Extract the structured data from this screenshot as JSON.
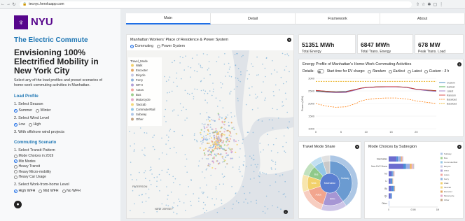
{
  "browser": {
    "url": "tecnyc.herokuapp.com"
  },
  "sidebar": {
    "logo_text": "NYU",
    "app_title": "The Electric Commute",
    "heading": "Envisioning 100% Electrified Mobility in New York City",
    "intro": "Select any of the load profiles and preset scenarios of home-work commuting activities in Manhattan.",
    "load_profile_title": "Load Profile",
    "season_label": "1. Select Season",
    "season_options": [
      "Summer",
      "Winter"
    ],
    "wind_label": "2. Select Wind Level",
    "wind_options": [
      "Low",
      "High"
    ],
    "offshore_label": "3. With offshore wind projects",
    "commuting_title": "Commuting Scenario",
    "transit_label": "1. Select Transit Pattern",
    "transit_options": [
      "Mode Choices in 2019",
      "Mix Modes",
      "Heavy Transit",
      "Heavy Micro-mobility",
      "Heavy Car Usage"
    ],
    "wfh_label": "2. Select Work-from-home Level",
    "wfh_options": [
      "High WFH",
      "Mid WFH",
      "No WFH"
    ]
  },
  "tabs": [
    "Main",
    "Detail",
    "Framework",
    "About"
  ],
  "map_card": {
    "title": "Manhattan Workers' Place of Residence & Power System",
    "toggle_options": [
      "Commuting",
      "Power System"
    ],
    "legend_title": "Travel_Mode",
    "legend_items": [
      {
        "label": "Walk",
        "color": "#f2d16b"
      },
      {
        "label": "Escooter",
        "color": "#e3a765"
      },
      {
        "label": "Bicycle",
        "color": "#c7c9e6"
      },
      {
        "label": "Ferry",
        "color": "#8fb3de"
      },
      {
        "label": "WFH",
        "color": "#b2a0d8"
      },
      {
        "label": "Autos",
        "color": "#f4a6a0"
      },
      {
        "label": "Bus",
        "color": "#9ed08f"
      },
      {
        "label": "Motorcycle",
        "color": "#e6a8c8"
      },
      {
        "label": "Taxicab",
        "color": "#f5d97c"
      },
      {
        "label": "CommuterRail",
        "color": "#93c7e6"
      },
      {
        "label": "Subway",
        "color": "#aec7e8"
      },
      {
        "label": "Other",
        "color": "#c4a484"
      }
    ],
    "place_labels": [
      "PATERSON",
      "NEW JERSEY"
    ]
  },
  "stats": [
    {
      "value": "51351 MWh",
      "label": "Total Energy"
    },
    {
      "value": "6847 MWh",
      "label": "Total Trans. Energy"
    },
    {
      "value": "678 MW",
      "label": "Peak Trans. Load"
    }
  ],
  "energy_card": {
    "title": "Energy Profile of Manhattan's Home-Work Commuting Activities",
    "details_label": "Details:",
    "ev_label": "Start time for EV charge:",
    "ev_options": [
      "Random",
      "Earliest",
      "Latest",
      "Custom - 3 h"
    ]
  },
  "chart_data": [
    {
      "type": "line",
      "title": "",
      "xlabel": "",
      "ylabel": "Power (MW)",
      "xlim": [
        0,
        24
      ],
      "ylim": [
        1000,
        3000
      ],
      "xticks": [
        0,
        5,
        10,
        15,
        20
      ],
      "yticks": [
        1000,
        1500,
        2000,
        2500,
        3000
      ],
      "legend_position": "right",
      "series": [
        {
          "name": "Custom",
          "color": "#1f77b4",
          "dash": false,
          "x": [
            0,
            2,
            4,
            6,
            8,
            9,
            10,
            12,
            14,
            16,
            18,
            19,
            20,
            22,
            24
          ],
          "y": [
            2520,
            2490,
            2470,
            2480,
            2560,
            2600,
            2630,
            2650,
            2660,
            2660,
            2640,
            2600,
            2560,
            2530,
            2510
          ]
        },
        {
          "name": "Earliest",
          "color": "#2ca02c",
          "dash": false,
          "x": [
            0,
            2,
            4,
            6,
            8,
            9,
            10,
            12,
            14,
            16,
            18,
            19,
            20,
            22,
            24
          ],
          "y": [
            2500,
            2470,
            2450,
            2460,
            2560,
            2610,
            2640,
            2660,
            2670,
            2670,
            2650,
            2610,
            2570,
            2530,
            2500
          ]
        },
        {
          "name": "Latest",
          "color": "#9467bd",
          "dash": false,
          "x": [
            0,
            2,
            4,
            6,
            8,
            9,
            10,
            12,
            14,
            16,
            18,
            19,
            20,
            22,
            24
          ],
          "y": [
            2480,
            2450,
            2430,
            2440,
            2540,
            2600,
            2630,
            2650,
            2660,
            2660,
            2640,
            2600,
            2560,
            2510,
            2480
          ]
        },
        {
          "name": "Random",
          "color": "#d62728",
          "dash": false,
          "x": [
            0,
            2,
            4,
            6,
            8,
            9,
            10,
            12,
            14,
            16,
            18,
            19,
            20,
            22,
            24
          ],
          "y": [
            2520,
            2490,
            2460,
            2470,
            2560,
            2610,
            2640,
            2660,
            2670,
            2670,
            2650,
            2610,
            2570,
            2540,
            2510
          ]
        },
        {
          "name": "Baseload",
          "color": "#ff7f0e",
          "dash": true,
          "x": [
            0,
            2,
            4,
            6,
            8,
            9,
            10,
            12,
            14,
            16,
            18,
            19,
            20,
            22,
            24
          ],
          "y": [
            2000,
            1900,
            1850,
            1870,
            2000,
            2100,
            2150,
            2200,
            2220,
            2220,
            2180,
            2150,
            2100,
            2050,
            2000
          ]
        },
        {
          "name": "Baseload",
          "color": "#e6a500",
          "dash": true,
          "x": [
            0,
            2,
            4,
            6,
            8,
            9,
            10,
            12,
            14,
            16,
            18,
            19,
            20,
            22,
            24
          ],
          "y": [
            2880,
            2880,
            2880,
            2880,
            2880,
            2880,
            2880,
            2880,
            2880,
            2880,
            2880,
            2880,
            2880,
            2880,
            2880
          ]
        }
      ]
    },
    {
      "type": "pie",
      "title": "Travel Mode Share",
      "labels": [
        "Subway",
        "WFH",
        "Autos",
        "Walk",
        "Bus",
        "CommuterRail",
        "Other"
      ],
      "values": [
        40,
        15,
        15,
        10,
        8,
        7,
        5
      ],
      "colors": [
        "#6b9bd1",
        "#a696d4",
        "#f2a58e",
        "#f2d16b",
        "#8fc98a",
        "#93c7e6",
        "#c9c9c9"
      ],
      "center_label": "Manhattan"
    },
    {
      "type": "bar",
      "title": "Mode Choices by Subregion",
      "orientation": "horizontal",
      "stacked": true,
      "categories": [
        "Manhattan",
        "Non-NYC Bronx",
        "NJ",
        "LI",
        "Bk",
        "Qn",
        "Other"
      ],
      "xlim": [
        0,
        1
      ],
      "xticks": [
        "0",
        "0.5M",
        "1M"
      ],
      "legend_position": "right",
      "legend": [
        "Subway",
        "Bus",
        "CommuterRail",
        "Bicycle",
        "WFH",
        "Autos",
        "Ferry",
        "Walk",
        "Taxicab",
        "Escooter",
        "Motorcycle",
        "Other"
      ],
      "legend_colors": [
        "#aec7e8",
        "#9ed08f",
        "#93c7e6",
        "#c7c9e6",
        "#b2a0d8",
        "#f4a6a0",
        "#8fb3de",
        "#f2d16b",
        "#f5d97c",
        "#e3a765",
        "#e6a8c8",
        "#c4a484"
      ],
      "series": [
        {
          "name": "Subway",
          "color": "#6b6ccf",
          "values": [
            0.16,
            0.3,
            0.06,
            0.04,
            0.06,
            0.04,
            0.0
          ]
        },
        {
          "name": "Bus",
          "color": "#4b8fd6",
          "values": [
            0.03,
            0.05,
            0.02,
            0.03,
            0.04,
            0.02,
            0.0
          ]
        },
        {
          "name": "WFH",
          "color": "#9bb0e6",
          "values": [
            0.06,
            0.08,
            0.02,
            0.01,
            0.02,
            0.01,
            0.01
          ]
        },
        {
          "name": "Autos",
          "color": "#f0b36a",
          "values": [
            0.02,
            0.04,
            0.01,
            0.01,
            0.01,
            0.0,
            0.0
          ]
        },
        {
          "name": "Walk",
          "color": "#e6b9d6",
          "values": [
            0.02,
            0.03,
            0.01,
            0.0,
            0.0,
            0.0,
            0.0
          ]
        },
        {
          "name": "Other",
          "color": "#c9c9c9",
          "values": [
            0.01,
            0.02,
            0.0,
            0.0,
            0.0,
            0.0,
            0.0
          ]
        }
      ]
    }
  ],
  "pie_card_title": "Travel Mode Share",
  "bar_card_title": "Mode Choices by Subregion"
}
